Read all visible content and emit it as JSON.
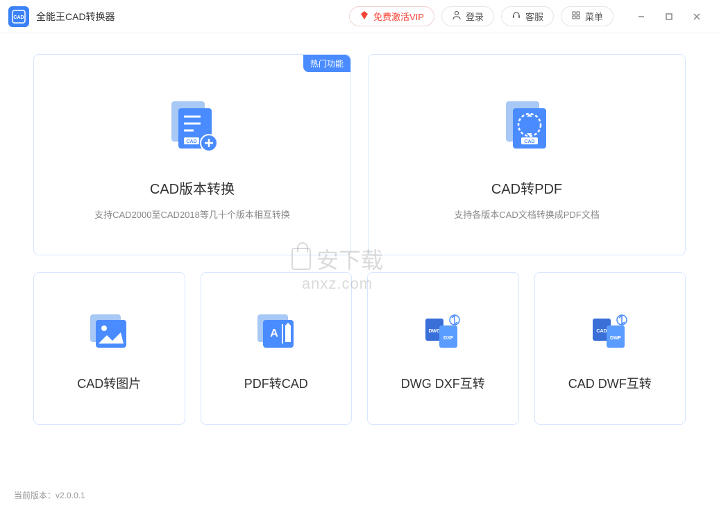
{
  "app": {
    "title": "全能王CAD转换器"
  },
  "titlebar": {
    "vip": "免费激活VIP",
    "login": "登录",
    "support": "客服",
    "menu": "菜单"
  },
  "cards": {
    "big": [
      {
        "title": "CAD版本转换",
        "desc": "支持CAD2000至CAD2018等几十个版本相互转换",
        "badge": "热门功能"
      },
      {
        "title": "CAD转PDF",
        "desc": "支持各版本CAD文档转换成PDF文档"
      }
    ],
    "small": [
      {
        "title": "CAD转图片"
      },
      {
        "title": "PDF转CAD"
      },
      {
        "title": "DWG DXF互转"
      },
      {
        "title": "CAD DWF互转"
      }
    ]
  },
  "footer": {
    "version_label": "当前版本：",
    "version": "v2.0.0.1"
  },
  "watermark": {
    "text": "安下载",
    "url": "anxz.com"
  }
}
